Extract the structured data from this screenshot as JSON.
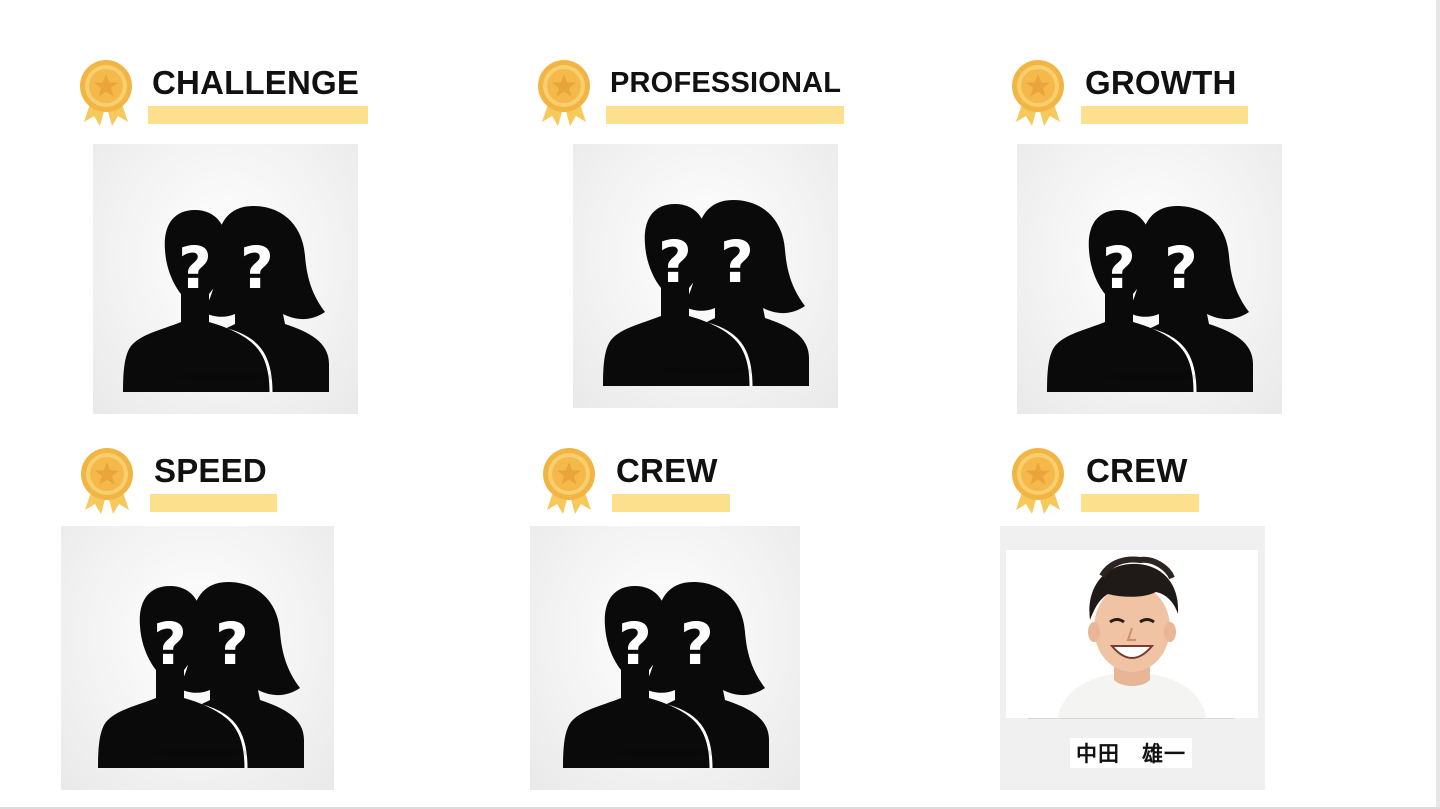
{
  "awards": [
    {
      "title": "CHALLENGE"
    },
    {
      "title": "PROFESSIONAL"
    },
    {
      "title": "GROWTH"
    },
    {
      "title": "SPEED"
    },
    {
      "title": "CREW"
    },
    {
      "title": "CREW",
      "winner_name": "中田　雄一"
    }
  ],
  "icons": {
    "badge": "award-medal-icon",
    "placeholder": "unknown-people-silhouette-icon"
  },
  "colors": {
    "underline": "#fde08e",
    "medal_gold": "#f2b544",
    "medal_ribbon": "#f6c95c",
    "card_bg": "#efefef"
  }
}
